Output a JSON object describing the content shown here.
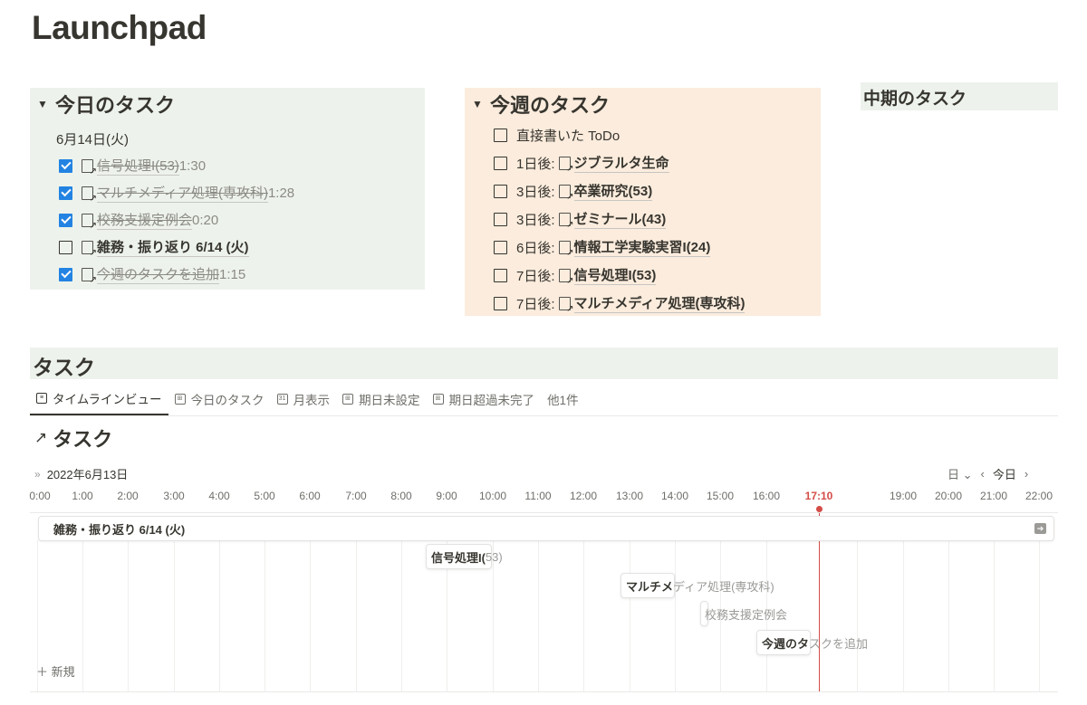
{
  "page": {
    "title": "Launchpad"
  },
  "today": {
    "title": "今日のタスク",
    "date": "6月14日(火)",
    "items": [
      {
        "label": "信号処理I(53)",
        "extra": "1:30",
        "checked": true
      },
      {
        "label": "マルチメディア処理(専攻科)",
        "extra": "1:28",
        "checked": true
      },
      {
        "label": "校務支援定例会",
        "extra": "0:20",
        "checked": true
      },
      {
        "label": "雑務・振り返り 6/14 (火)",
        "extra": "",
        "checked": false
      },
      {
        "label": "今週のタスクを追加",
        "extra": "1:15",
        "checked": true
      }
    ]
  },
  "week": {
    "title": "今週のタスク",
    "items": [
      {
        "prefix": "",
        "label": "直接書いた ToDo",
        "checked": false
      },
      {
        "prefix": "1日後:",
        "label": "ジブラルタ生命",
        "checked": false
      },
      {
        "prefix": "3日後:",
        "label": "卒業研究(53)",
        "checked": false
      },
      {
        "prefix": "3日後:",
        "label": "ゼミナール(43)",
        "checked": false
      },
      {
        "prefix": "6日後:",
        "label": "情報工学実験実習I(24)",
        "checked": false
      },
      {
        "prefix": "7日後:",
        "label": "信号処理I(53)",
        "checked": false
      },
      {
        "prefix": "7日後:",
        "label": "マルチメディア処理(専攻科)",
        "checked": false
      }
    ]
  },
  "mid": {
    "title": "中期のタスク"
  },
  "tasks": {
    "title": "タスク",
    "tabs": [
      "タイムラインビュー",
      "今日のタスク",
      "月表示",
      "期日未設定",
      "期日超過未完了"
    ],
    "more": "他1件",
    "db_title": "タスク",
    "timeline": {
      "date": "2022年6月13日",
      "unit": "日",
      "today_btn": "今日",
      "hours": [
        "0:00",
        "1:00",
        "2:00",
        "3:00",
        "4:00",
        "5:00",
        "6:00",
        "7:00",
        "8:00",
        "9:00",
        "10:00",
        "11:00",
        "12:00",
        "13:00",
        "14:00",
        "15:00",
        "16:00",
        "17:10",
        "19:00",
        "20:00",
        "21:00",
        "22:00"
      ],
      "now_label": "17:10",
      "allday": "雑務・振り返り 6/14 (火)",
      "bars": [
        {
          "inside": "信号処理I(",
          "outside": "53)"
        },
        {
          "inside": "マルチメ",
          "outside": "ディア処理(専攻科)"
        },
        {
          "inside": "",
          "outside": "校務支援定例会"
        },
        {
          "inside": "今週のタ",
          "outside": "スクを追加"
        }
      ],
      "new_label": "新規"
    }
  },
  "colors": {
    "green_bg": "#edf3ec",
    "orange_bg": "#fbecdd",
    "accent": "#2383e2",
    "now": "#d44c47"
  }
}
